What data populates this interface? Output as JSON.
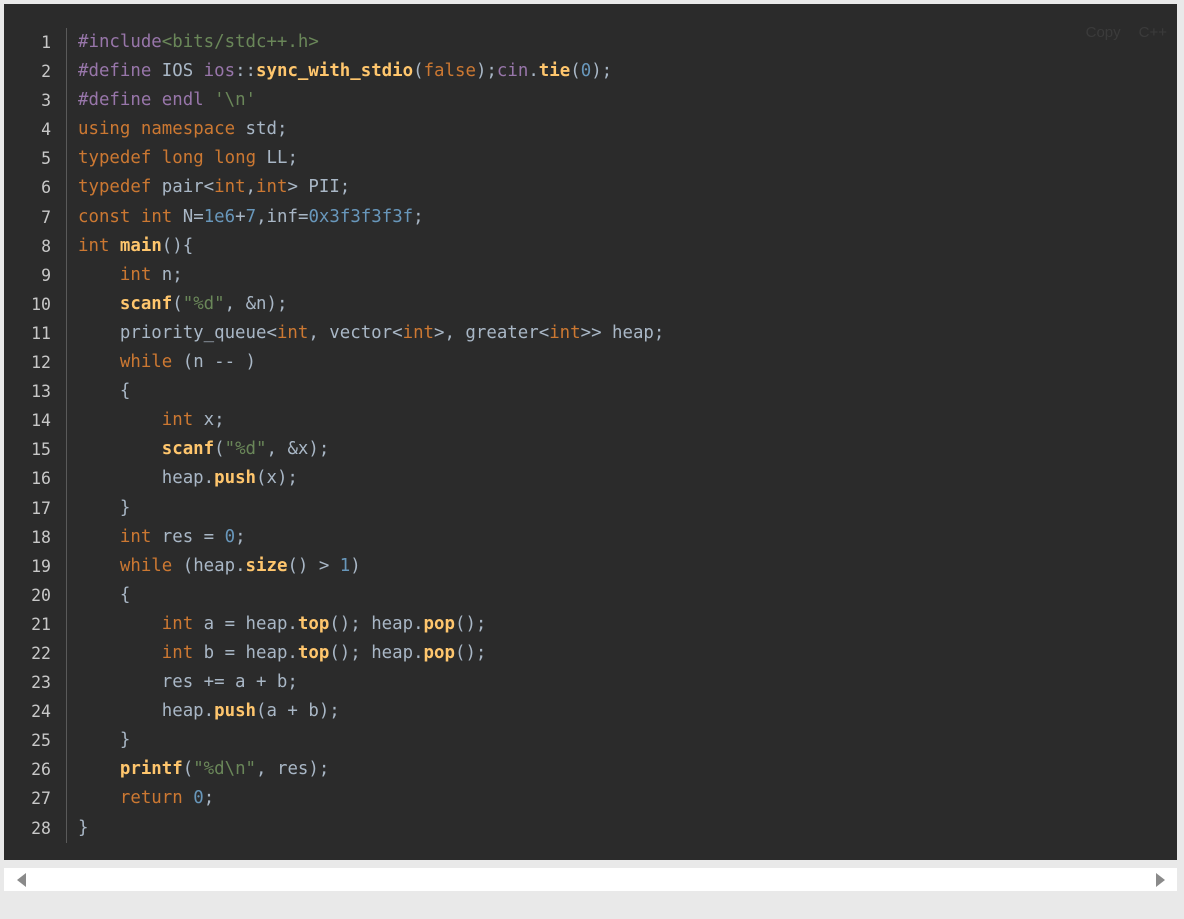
{
  "toolbar": {
    "copy_label": "Copy",
    "lang_label": "C++"
  },
  "colors": {
    "default": "#a9b7c6",
    "keyword": "#cc7832",
    "preprocessor": "#9876aa",
    "string": "#6a8759",
    "number": "#6897bb",
    "function": "#ffc66d",
    "line_number": "#c8c8c8",
    "background": "#2b2b2b"
  },
  "scrollbar": {
    "left_icon": "arrow-left-icon",
    "right_icon": "arrow-right-icon"
  },
  "code_lines": [
    [
      [
        "#include",
        "p"
      ],
      [
        "<bits/stdc++.h>",
        "s"
      ]
    ],
    [
      [
        "#define",
        "p"
      ],
      [
        " IOS ",
        "d"
      ],
      [
        "ios",
        "p"
      ],
      [
        "::",
        "d"
      ],
      [
        "sync_with_stdio",
        "f"
      ],
      [
        "(",
        "d"
      ],
      [
        "false",
        "k"
      ],
      [
        ");",
        "d"
      ],
      [
        "cin",
        "p"
      ],
      [
        ".",
        "d"
      ],
      [
        "tie",
        "f"
      ],
      [
        "(",
        "d"
      ],
      [
        "0",
        "n"
      ],
      [
        ");",
        "d"
      ]
    ],
    [
      [
        "#define",
        "p"
      ],
      [
        " endl ",
        "p"
      ],
      [
        "'\\n'",
        "s"
      ]
    ],
    [
      [
        "using",
        "k"
      ],
      [
        " ",
        "d"
      ],
      [
        "namespace",
        "k"
      ],
      [
        " std;",
        "d"
      ]
    ],
    [
      [
        "typedef",
        "k"
      ],
      [
        " ",
        "d"
      ],
      [
        "long",
        "k"
      ],
      [
        " ",
        "d"
      ],
      [
        "long",
        "k"
      ],
      [
        " LL;",
        "d"
      ]
    ],
    [
      [
        "typedef",
        "k"
      ],
      [
        " pair<",
        "d"
      ],
      [
        "int",
        "k"
      ],
      [
        ",",
        "d"
      ],
      [
        "int",
        "k"
      ],
      [
        "> PII;",
        "d"
      ]
    ],
    [
      [
        "const",
        "k"
      ],
      [
        " ",
        "d"
      ],
      [
        "int",
        "k"
      ],
      [
        " N=",
        "d"
      ],
      [
        "1e6",
        "n"
      ],
      [
        "+",
        "d"
      ],
      [
        "7",
        "n"
      ],
      [
        ",inf=",
        "d"
      ],
      [
        "0x3f3f3f3f",
        "n"
      ],
      [
        ";",
        "d"
      ]
    ],
    [
      [
        "int",
        "k"
      ],
      [
        " ",
        "d"
      ],
      [
        "main",
        "f"
      ],
      [
        "(){",
        "d"
      ]
    ],
    [
      [
        "    ",
        "d"
      ],
      [
        "int",
        "k"
      ],
      [
        " n;",
        "d"
      ]
    ],
    [
      [
        "    ",
        "d"
      ],
      [
        "scanf",
        "f"
      ],
      [
        "(",
        "d"
      ],
      [
        "\"%d\"",
        "s"
      ],
      [
        ", &n);",
        "d"
      ]
    ],
    [
      [
        "    priority_queue<",
        "d"
      ],
      [
        "int",
        "k"
      ],
      [
        ", vector<",
        "d"
      ],
      [
        "int",
        "k"
      ],
      [
        ">, greater<",
        "d"
      ],
      [
        "int",
        "k"
      ],
      [
        ">> heap;",
        "d"
      ]
    ],
    [
      [
        "    ",
        "d"
      ],
      [
        "while",
        "k"
      ],
      [
        " (n -- )",
        "d"
      ]
    ],
    [
      [
        "    {",
        "d"
      ]
    ],
    [
      [
        "        ",
        "d"
      ],
      [
        "int",
        "k"
      ],
      [
        " x;",
        "d"
      ]
    ],
    [
      [
        "        ",
        "d"
      ],
      [
        "scanf",
        "f"
      ],
      [
        "(",
        "d"
      ],
      [
        "\"%d\"",
        "s"
      ],
      [
        ", &x);",
        "d"
      ]
    ],
    [
      [
        "        heap.",
        "d"
      ],
      [
        "push",
        "f"
      ],
      [
        "(x);",
        "d"
      ]
    ],
    [
      [
        "    }",
        "d"
      ]
    ],
    [
      [
        "    ",
        "d"
      ],
      [
        "int",
        "k"
      ],
      [
        " res = ",
        "d"
      ],
      [
        "0",
        "n"
      ],
      [
        ";",
        "d"
      ]
    ],
    [
      [
        "    ",
        "d"
      ],
      [
        "while",
        "k"
      ],
      [
        " (heap.",
        "d"
      ],
      [
        "size",
        "f"
      ],
      [
        "() > ",
        "d"
      ],
      [
        "1",
        "n"
      ],
      [
        ")",
        "d"
      ]
    ],
    [
      [
        "    {",
        "d"
      ]
    ],
    [
      [
        "        ",
        "d"
      ],
      [
        "int",
        "k"
      ],
      [
        " a = heap.",
        "d"
      ],
      [
        "top",
        "f"
      ],
      [
        "(); heap.",
        "d"
      ],
      [
        "pop",
        "f"
      ],
      [
        "();",
        "d"
      ]
    ],
    [
      [
        "        ",
        "d"
      ],
      [
        "int",
        "k"
      ],
      [
        " b = heap.",
        "d"
      ],
      [
        "top",
        "f"
      ],
      [
        "(); heap.",
        "d"
      ],
      [
        "pop",
        "f"
      ],
      [
        "();",
        "d"
      ]
    ],
    [
      [
        "        res += a + b;",
        "d"
      ]
    ],
    [
      [
        "        heap.",
        "d"
      ],
      [
        "push",
        "f"
      ],
      [
        "(a + b);",
        "d"
      ]
    ],
    [
      [
        "    }",
        "d"
      ]
    ],
    [
      [
        "    ",
        "d"
      ],
      [
        "printf",
        "f"
      ],
      [
        "(",
        "d"
      ],
      [
        "\"%d\\n\"",
        "s"
      ],
      [
        ", res);",
        "d"
      ]
    ],
    [
      [
        "    ",
        "d"
      ],
      [
        "return",
        "k"
      ],
      [
        " ",
        "d"
      ],
      [
        "0",
        "n"
      ],
      [
        ";",
        "d"
      ]
    ],
    [
      [
        "}",
        "d"
      ]
    ]
  ]
}
